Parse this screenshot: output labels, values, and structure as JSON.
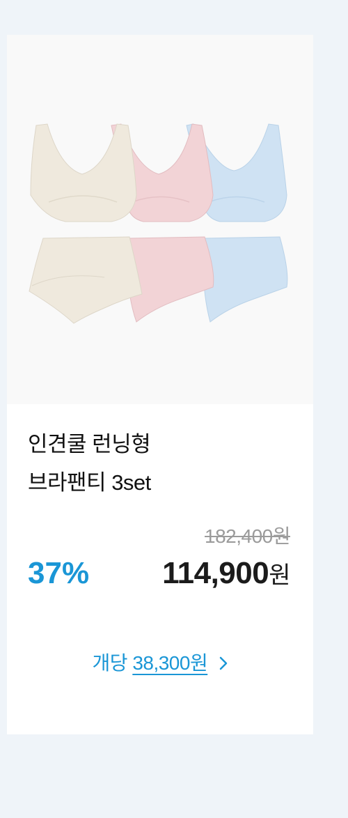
{
  "product": {
    "name_line1": "인견쿨 런닝형",
    "name_line2": "브라팬티 3set",
    "original_price": "182,400원",
    "discount": "37%",
    "price_amount": "114,900",
    "price_unit": "원",
    "unit_price_label": "개당",
    "unit_price_amount": "38,300원",
    "image_colors": [
      "#efe9dd",
      "#f2d3d6",
      "#cfe2f3"
    ]
  }
}
